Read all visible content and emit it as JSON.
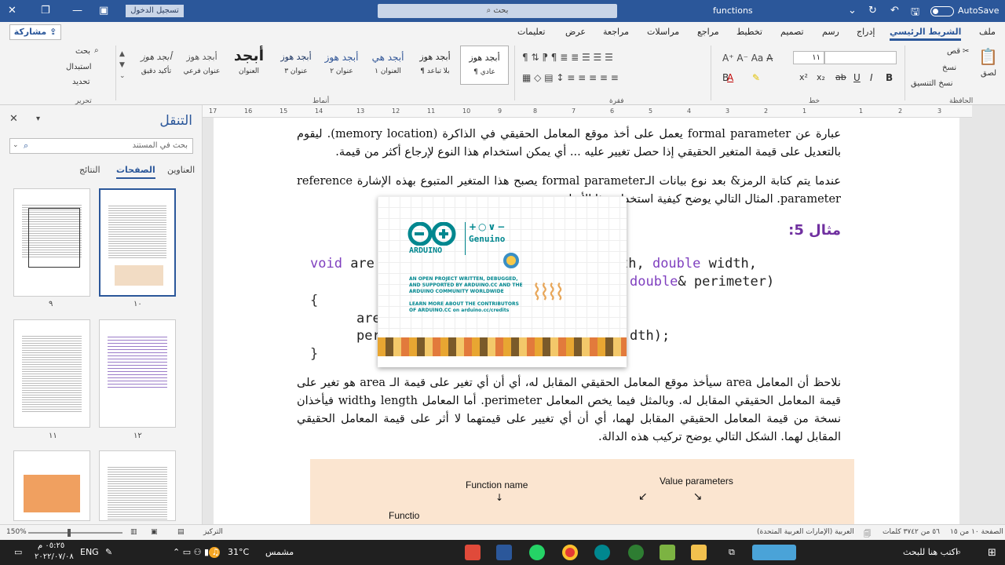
{
  "titlebar": {
    "doc_name": "functions",
    "autosave_label": "AutoSave",
    "search_placeholder": "بحث",
    "signin_label": "تسجيل الدخول"
  },
  "ribbon_tabs": [
    "ملف",
    "الشريط الرئيسي",
    "إدراج",
    "رسم",
    "تصميم",
    "تخطيط",
    "مراجع",
    "مراسلات",
    "مراجعة",
    "عرض",
    "تعليمات"
  ],
  "share_label": "مشاركة",
  "clipboard": {
    "paste": "لصق",
    "cut": "قص",
    "copy": "نسخ",
    "format_painter": "نسخ التنسيق",
    "group": "الحافظة"
  },
  "font": {
    "size": "١١",
    "group": "خط"
  },
  "paragraph_group": "فقرة",
  "styles": {
    "group": "أنماط",
    "items": [
      {
        "sample": "أبجد هوز",
        "name": "¶ عادي"
      },
      {
        "sample": "أبجد هوز",
        "name": "¶ بلا تباعد"
      },
      {
        "sample": "أبجد هي",
        "name": "العنوان ١"
      },
      {
        "sample": "أبجد هوز",
        "name": "عنوان ٢"
      },
      {
        "sample": "أبجد هوز",
        "name": "عنوان ٣"
      },
      {
        "sample": "أبجد",
        "name": "العنوان"
      },
      {
        "sample": "أبجد هوز",
        "name": "عنوان فرعي"
      },
      {
        "sample": "أبجد هوز",
        "name": "تأكيد دقيق"
      }
    ]
  },
  "editing": {
    "find": "بحث",
    "replace": "استبدال",
    "select": "تحديد",
    "group": "تحرير"
  },
  "ruler_numbers": [
    "3",
    "2",
    "1",
    "1",
    "2",
    "3",
    "4",
    "5",
    "6",
    "7",
    "8",
    "9",
    "10",
    "11",
    "12",
    "13",
    "14",
    "15",
    "16",
    "17"
  ],
  "nav": {
    "title": "التنقل",
    "search_placeholder": "بحث في المستند",
    "tabs": [
      "العناوين",
      "الصفحات",
      "النتائج"
    ],
    "page_labels": [
      "٩",
      "١٠",
      "١١",
      "١٢"
    ]
  },
  "document": {
    "para1": "عبارة عن formal parameter يعمل على أخذ موقع المعامل الحقيقي في الذاكرة (memory location). ليقوم بالتعديل على قيمة المتغير الحقيقي إذا حصل تغيير عليه ... أي يمكن استخدام هذا النوع لإرجاع أكثر من قيمة.",
    "para2": "عندما يتم كتابة الرمز& بعد نوع بيانات الـformal parameter يصبح هذا المتغير المتبوع بهذه الإشارة reference parameter. المثال التالي يوضح كيفية استخدام هذا الأسلوب:",
    "example_label": "مثال 5:",
    "code": {
      "l1a": "void",
      "l1b": " are",
      "l1c": "th, ",
      "l1d": "double",
      "l1e": " width,",
      "l2a": "double",
      "l2b": "& perimeter)",
      "l3": "{",
      "l4": "are",
      "l5a": "per",
      "l5b": "dth);",
      "l6": "}"
    },
    "para3": "نلاحظ أن المعامل area سيأخذ موقع المعامل الحقيقي المقابل له، أي أن أي تغير على قيمة الـ area هو تغير على قيمة المعامل الحقيقي المقابل له. وبالمثل فيما يخص المعامل perimeter. أما المعامل length وwidth فيأخذان نسخة من قيمة المعامل الحقيقي المقابل لهما، أي أن أي تغيير على قيمتهما لا أثر على قيمة المعامل الحقيقي المقابل لهما. الشكل التالي يوضح تركيب هذه الدالة.",
    "figure": {
      "label1": "Function name",
      "label2": "Value parameters",
      "label3": "Functio"
    }
  },
  "splash": {
    "brand": "ARDUINO",
    "genuino": "Genuino",
    "blurb": "AN OPEN PROJECT WRITTEN, DEBUGGED, AND SUPPORTED BY ARDUINO.CC AND THE ARDUINO COMMUNITY WORLDWIDE",
    "credits": "LEARN MORE ABOUT THE CONTRIBUTORS OF ARDUINO.CC on arduino.cc/credits"
  },
  "status": {
    "page": "الصفحة ١٠ من ١٥",
    "words": "٥٦ من ٣٧٤٢ كلمات",
    "language": "العربية (الإمارات العربية المتحدة)",
    "focus": "التركيز",
    "zoom": "150%"
  },
  "taskbar": {
    "search": "اكتب هنا للبحث",
    "weather_text": "مشمس",
    "temp": "31°C",
    "lang": "ENG",
    "time": "٠٥:٢٥ م",
    "date": "٢٠٢٢/٠٧/٠٨"
  }
}
